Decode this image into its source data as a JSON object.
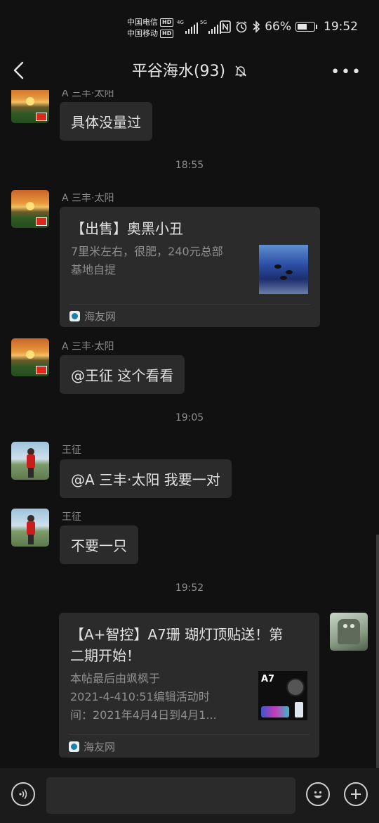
{
  "statusbar": {
    "carrier1": "中国电信",
    "carrier2": "中国移动",
    "hd": "HD",
    "net1": "4G",
    "net2": "5G",
    "battery_pct": "66%",
    "battery_level": 0.66,
    "time": "19:52"
  },
  "header": {
    "title": "平谷海水(93)"
  },
  "messages": {
    "m1": {
      "sender": "A 三丰·太阳",
      "text": "具体没量过"
    },
    "t1": "18:55",
    "m2": {
      "sender": "A 三丰·太阳",
      "title": "【出售】奥黑小丑",
      "desc1": "7里米左右，很肥，240元总部",
      "desc2": "基地自提",
      "source": "海友网"
    },
    "m3": {
      "sender": "A 三丰·太阳",
      "text": "@王征  这个看看"
    },
    "t2": "19:05",
    "m4": {
      "sender": "王征",
      "text": "@A 三丰·太阳  我要一对"
    },
    "m5": {
      "sender": "王征",
      "text": "不要一只"
    },
    "t3": "19:52",
    "m6": {
      "title1": "【A+智控】A7珊 瑚灯顶贴送！第",
      "title2": "二期开始！",
      "desc1": "本帖最后由飒枫于",
      "desc2": "2021-4-410:51编辑活动时",
      "desc3": "间：2021年4月4日到4月1...",
      "thumb_text": "A7",
      "source": "海友网"
    }
  }
}
